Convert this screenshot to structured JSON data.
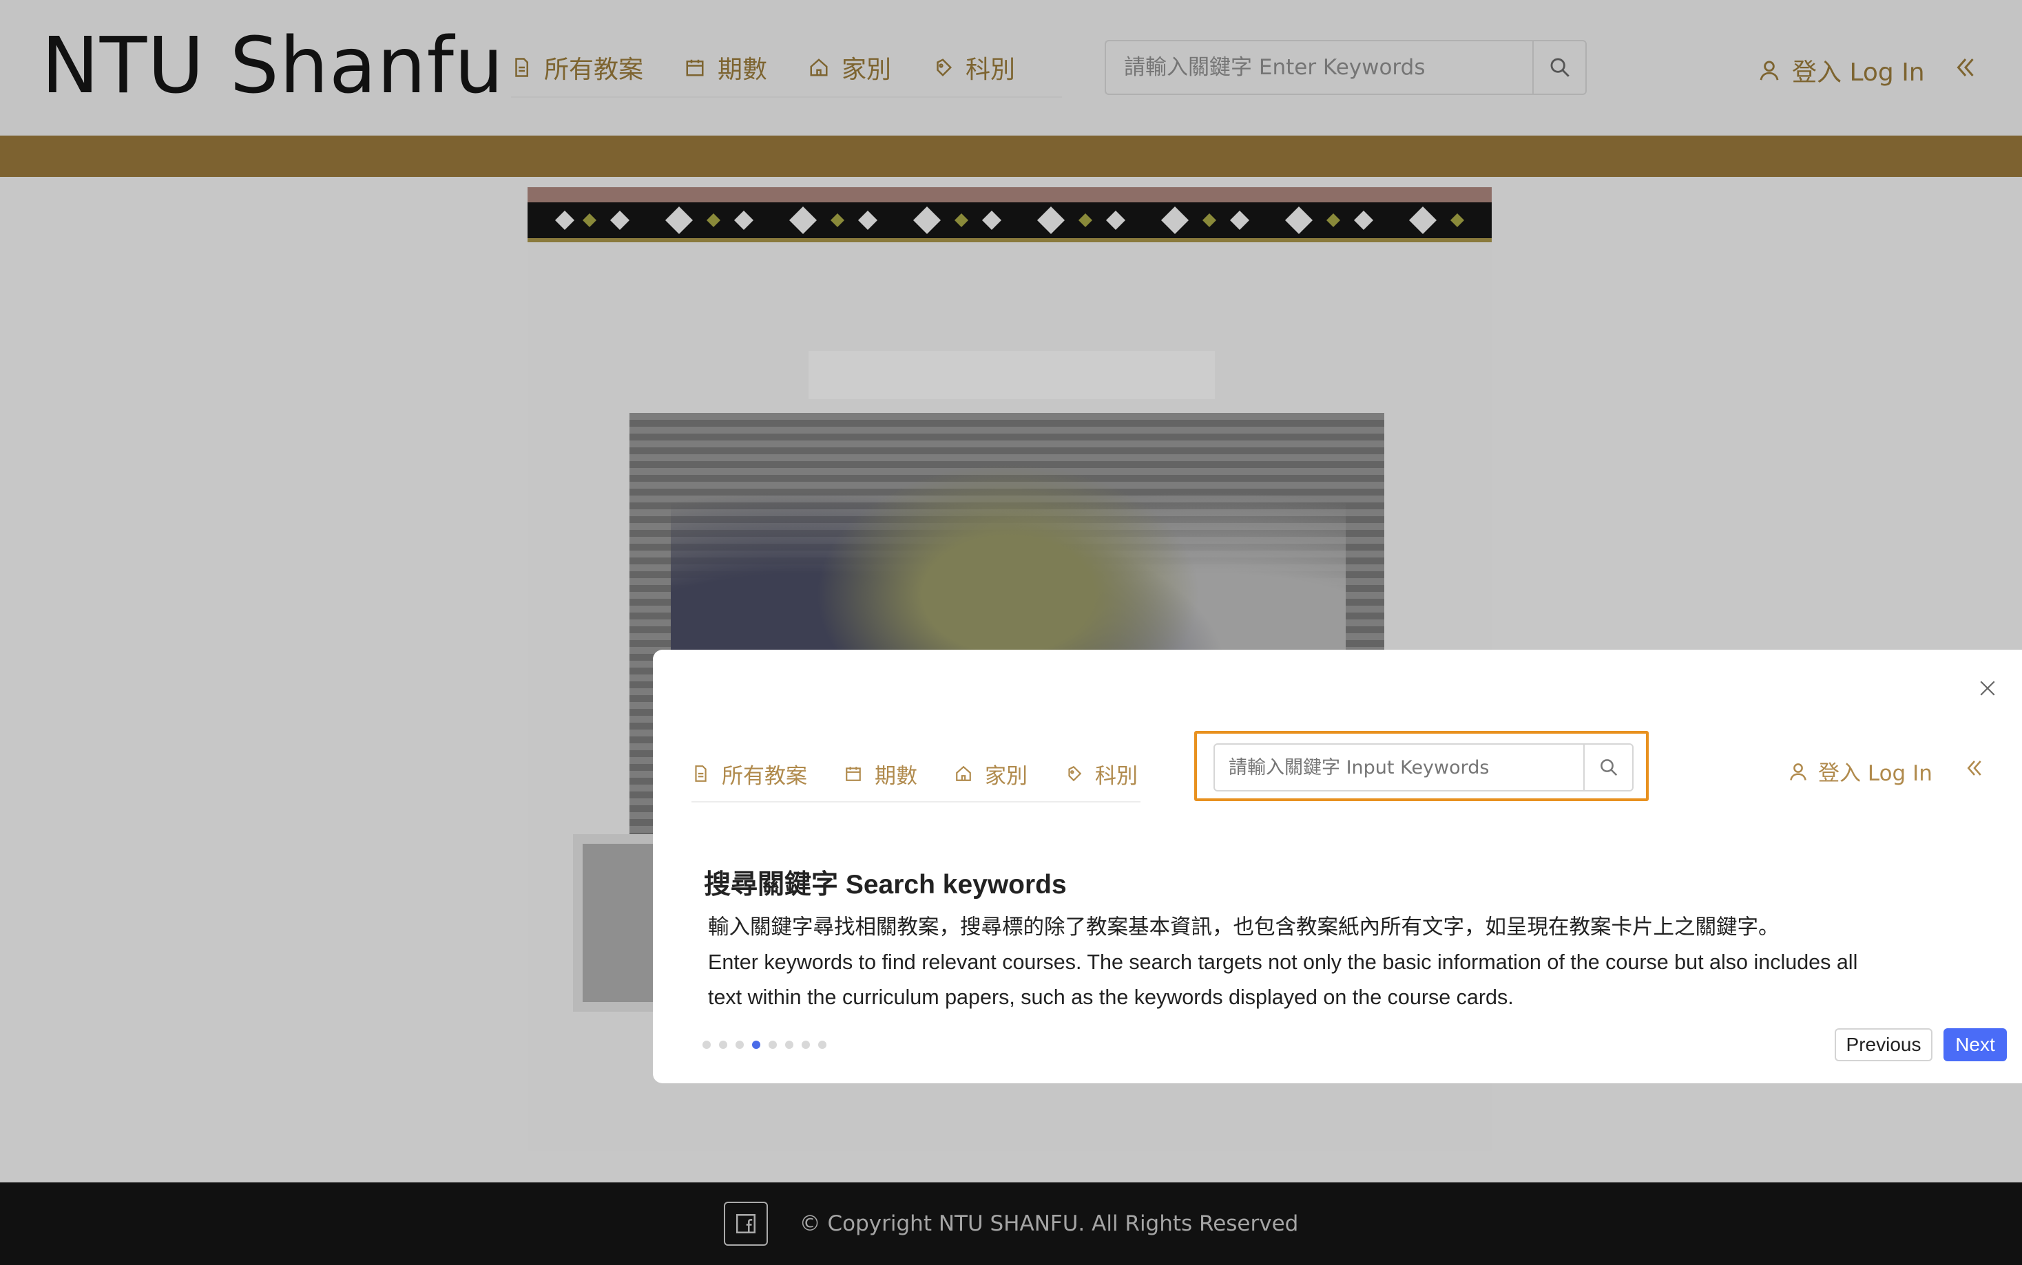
{
  "header": {
    "logo": "NTU Shanfu",
    "nav": [
      {
        "label": "所有教案",
        "icon": "document-icon"
      },
      {
        "label": "期數",
        "icon": "calendar-icon"
      },
      {
        "label": "家別",
        "icon": "home-icon"
      },
      {
        "label": "科別",
        "icon": "tag-icon"
      }
    ],
    "search_placeholder": "請輸入關鍵字 Enter Keywords",
    "login_label": "登入 Log In",
    "collapse_icon": "double-chevron-left-icon"
  },
  "modal": {
    "nav": [
      {
        "label": "所有教案",
        "icon": "document-icon"
      },
      {
        "label": "期數",
        "icon": "calendar-icon"
      },
      {
        "label": "家別",
        "icon": "home-icon"
      },
      {
        "label": "科別",
        "icon": "tag-icon"
      }
    ],
    "search_placeholder": "請輸入關鍵字 Input Keywords",
    "login_label": "登入 Log In",
    "title": "搜尋關鍵字 Search keywords",
    "desc_line1": "輸入關鍵字尋找相關教案，搜尋標的除了教案基本資訊，也包含教案紙內所有文字，如呈現在教案卡片上之關鍵字。",
    "desc_line2": "Enter keywords to find relevant courses. The search targets not only the basic information of the course but also includes all",
    "desc_line3": "text within the curriculum papers, such as the keywords displayed on the course cards.",
    "steps_total": 8,
    "steps_current": 4,
    "prev_label": "Previous",
    "next_label": "Next"
  },
  "footer": {
    "copyright": "© Copyright NTU SHANFU. All Rights Reserved"
  },
  "colors": {
    "accent_gold": "#7d6230",
    "highlight": "#e8911f",
    "primary": "#4a6cf7"
  }
}
